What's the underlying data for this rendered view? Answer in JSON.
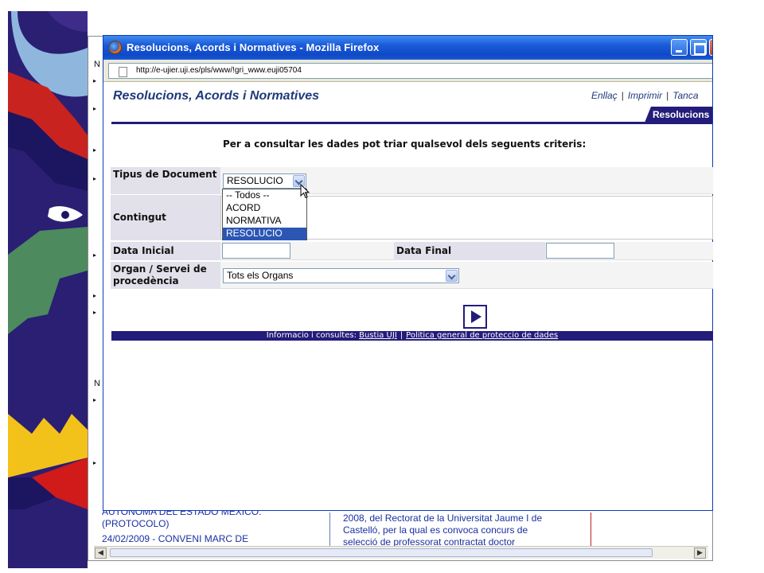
{
  "window": {
    "title": "Resolucions, Acords i Normatives - Mozilla Firefox",
    "url": "http://e-ujier.uji.es/pls/www/!gri_www.euji05704"
  },
  "header": {
    "title": "Resolucions, Acords i Normatives",
    "links": [
      "Enllaç",
      "Imprimir",
      "Tanca"
    ],
    "link_separator": "|",
    "tab": "Resolucions"
  },
  "form": {
    "instructions": "Per a consultar les dades pot triar qualsevol dels seguents criteris:",
    "document_type": {
      "label": "Tipus de Document",
      "selected": "RESOLUCIO",
      "options": [
        "-- Todos --",
        "ACORD",
        "NORMATIVA",
        "RESOLUCIO"
      ]
    },
    "content": {
      "label": "Contingut"
    },
    "start_date": {
      "label": "Data Inicial"
    },
    "end_date": {
      "label": "Data Final"
    },
    "organ": {
      "label": "Organ / Servei de procedència",
      "selected": "Tots els Organs"
    }
  },
  "footer": {
    "prefix": "Informacio i consultes:",
    "link1": "Bustia UJI",
    "separator": "|",
    "link2": "Politica general de proteccio de dades"
  },
  "background_page": {
    "left_items": [
      "AUTONOMA DEL ESTADO MEXICO.",
      "(PROTOCOLO)",
      "24/02/2009 - CONVENI MARC DE"
    ],
    "right_items": [
      "2008, del Rectorat de la Universitat Jaume I de",
      "Castelló, per la qual es convoca concurs de",
      "selecció de professorat contractat doctor"
    ],
    "stub_letter": "N"
  },
  "colors": {
    "brand": "#241c7a",
    "title_blue": "#1f3a7a",
    "titlebar": "#1a5ad8",
    "selection": "#2b56b4"
  }
}
